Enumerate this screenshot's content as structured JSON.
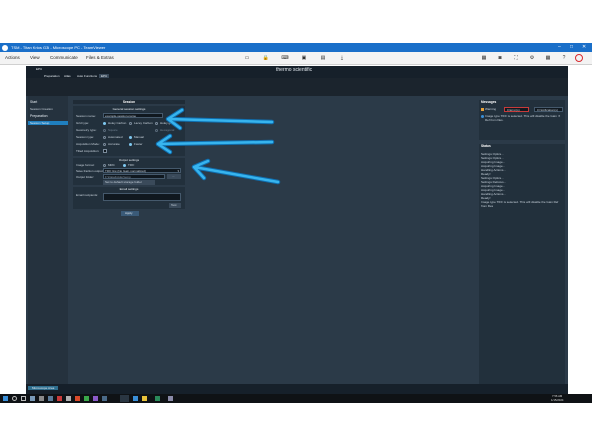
{
  "teamviewer": {
    "title": "TSM - Titan Krios G3i - Microscope PC - TeamViewer",
    "menus": [
      "Actions",
      "View",
      "Communicate",
      "Files & Extras"
    ]
  },
  "app": {
    "window_label": "EPU",
    "tabs": [
      "Preparation",
      "Atlas",
      "Auto Functions",
      "EPU"
    ],
    "brand": "thermo scientific"
  },
  "left_panel": {
    "sections": [
      "Start",
      "Session Creation",
      "Preparation",
      "Session Setup"
    ]
  },
  "session_panel": {
    "header": "Session",
    "general_title": "General session settings",
    "rows": [
      {
        "label": "Session name:",
        "value": "example-session-name"
      },
      {
        "label": "Grid type:",
        "options": [
          "Holey Carbon",
          "Lacey Carbon",
          "Holey gold"
        ]
      },
      {
        "label": "Geometry type:",
        "options": [
          "Square",
          "Hexagonal"
        ]
      },
      {
        "label": "Session type:",
        "options": [
          "Automated",
          "Manual"
        ]
      },
      {
        "label": "Acquisition Mode:",
        "options": [
          "Accurate",
          "Faster"
        ]
      },
      {
        "label": "Tilted Acquisition:"
      }
    ],
    "output_title": "Output settings",
    "image_format_label": "Image format:",
    "image_format_options": [
      "MRC",
      "TIFF"
    ],
    "save_label": "Save fraction output file:",
    "save_value": "TIFF lzw (No Gain normalized)",
    "output_folder_label": "Output folder:",
    "output_folder_value": "F:\\DataFolder\\temp",
    "browse_button": "...",
    "default_button": "Set to default storage folder",
    "email_title": "Email settings",
    "email_label": "Email recipients:",
    "email_button": "Test",
    "apply_button": "Apply"
  },
  "messages_panel": {
    "title": "Messages",
    "filters": [
      "Warning",
      "0 Error(s)",
      "0 Notification(s)"
    ],
    "message": "Image type TIFF is selected. This will disable the Gain Ref from files."
  },
  "status_panel": {
    "title": "Status",
    "lines": [
      "Settings Optics...",
      "Settings Optics...",
      "Acquiring Image...",
      "Acquiring Image...",
      "Handling Actions...",
      "Ready!",
      "Settings Optics...",
      "Settings Defocus...",
      "Acquiring Image...",
      "Acquiring Image...",
      "Handling Actions...",
      "Ready!",
      "Image type TIFF is selected. This will disable the Gain Ref from files"
    ]
  },
  "bottom_tab": "Microscope Area",
  "taskbar": {
    "time": "7:56 AM",
    "date": "1/15/2024"
  },
  "colors": {
    "teamviewer_bar": "#1a6fc9",
    "app_bg": "#2b3a48",
    "arrow": "#1fa3e0"
  }
}
